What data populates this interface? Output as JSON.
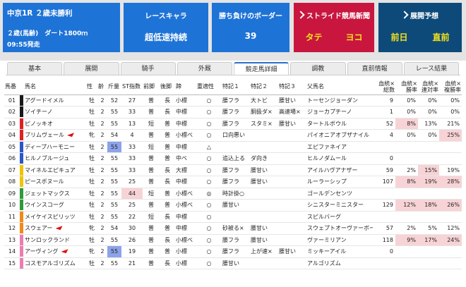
{
  "race": {
    "title": "中京1R ２歳未勝利",
    "cond": "２歳(馬齢)　ダート1800ｍ",
    "time": "09:55発走"
  },
  "cards": [
    {
      "header": "レースキャラ",
      "value": "超低速持続"
    },
    {
      "header": "勝ち負けのボーダー",
      "value": "39"
    },
    {
      "header": "ストライド競馬新聞",
      "a": "タテ",
      "b": "ヨコ"
    },
    {
      "header": "展開予想",
      "a": "前日",
      "b": "直前"
    }
  ],
  "tabs": [
    "基本",
    "展開",
    "騎手",
    "外厩",
    "競走馬詳細",
    "調教",
    "直前情報",
    "レース結果"
  ],
  "columns": [
    "馬番",
    "馬名",
    "性",
    "齢",
    "斤量",
    "ST指数",
    "前脚",
    "後脚",
    "蹄",
    "重適性",
    "特記１",
    "特記２",
    "特記３",
    "父馬名",
    "血統×総数",
    "血統×勝率",
    "血統×連対率",
    "血統×複勝率"
  ],
  "colors": {
    "header_bg": "#1e73d6",
    "shinbun_bg": "#c8163f",
    "tenkai_bg": "#0d4a7a",
    "highlight_pink": "#f7d3d6",
    "highlight_blue": "#8ca3ea",
    "sub_text": "#f5e21a"
  },
  "horses": [
    {
      "no": "01",
      "name": "アグードイメル",
      "sex": "牡",
      "age": "2",
      "kin": "52",
      "st": "27",
      "mae": "普",
      "ato": "長",
      "tei": "小標",
      "om": "○",
      "s1": "腰フラ",
      "s2": "大トビ",
      "s3": "腰甘い",
      "sire": "トーセンジョーダン",
      "tot": "9",
      "w": "0%",
      "r": "0%",
      "f": "0%",
      "color": "#1a1a1a",
      "flag": false,
      "kinH": "",
      "stH": "",
      "wH": "",
      "rH": "",
      "fH": ""
    },
    {
      "no": "02",
      "name": "ソイチーノ",
      "sex": "牡",
      "age": "2",
      "kin": "55",
      "st": "33",
      "mae": "普",
      "ato": "長",
      "tei": "中標",
      "om": "○",
      "s1": "腰フラ",
      "s2": "胴扱ダ×",
      "s3": "高速場×",
      "sire": "ジョーカプチーノ",
      "tot": "1",
      "w": "0%",
      "r": "0%",
      "f": "0%",
      "color": "#1a1a1a",
      "flag": false,
      "kinH": "",
      "stH": "",
      "wH": "",
      "rH": "",
      "fH": ""
    },
    {
      "no": "03",
      "name": "ピノッキオ",
      "sex": "牡",
      "age": "2",
      "kin": "55",
      "st": "13",
      "mae": "短",
      "ato": "普",
      "tei": "中標",
      "om": "○",
      "s1": "腰フラ",
      "s2": "スタミ×",
      "s3": "腰甘い",
      "sire": "タートルボウル",
      "tot": "52",
      "w": "8%",
      "r": "13%",
      "f": "21%",
      "color": "#e02020",
      "flag": false,
      "kinH": "",
      "stH": "",
      "wH": "pk",
      "rH": "",
      "fH": ""
    },
    {
      "no": "04",
      "name": "ブリムヴェール",
      "sex": "牝",
      "age": "2",
      "kin": "54",
      "st": "4",
      "mae": "普",
      "ato": "普",
      "tei": "小標べ",
      "om": "○",
      "s1": "口向悪い",
      "s2": "",
      "s3": "",
      "sire": "パイオニアオブザナイル",
      "tot": "4",
      "w": "0%",
      "r": "0%",
      "f": "25%",
      "color": "#e02020",
      "flag": true,
      "kinH": "",
      "stH": "",
      "wH": "",
      "rH": "",
      "fH": "pk"
    },
    {
      "no": "05",
      "name": "ディープハーモニー",
      "sex": "牡",
      "age": "2",
      "kin": "55",
      "st": "33",
      "mae": "短",
      "ato": "普",
      "tei": "中標",
      "om": "△",
      "s1": "",
      "s2": "",
      "s3": "",
      "sire": "エピファネイア",
      "tot": "",
      "w": "",
      "r": "",
      "f": "",
      "color": "#2a56c6",
      "flag": false,
      "kinH": "bl",
      "stH": "",
      "wH": "",
      "rH": "",
      "fH": ""
    },
    {
      "no": "06",
      "name": "ヒルノブルージュ",
      "sex": "牡",
      "age": "2",
      "kin": "55",
      "st": "33",
      "mae": "普",
      "ato": "普",
      "tei": "中べ",
      "om": "○",
      "s1": "追込上る",
      "s2": "ダ向き",
      "s3": "",
      "sire": "ヒルノダムール",
      "tot": "0",
      "w": "",
      "r": "",
      "f": "",
      "color": "#2a56c6",
      "flag": false,
      "kinH": "",
      "stH": "",
      "wH": "",
      "rH": "",
      "fH": ""
    },
    {
      "no": "07",
      "name": "マイネルエピキュア",
      "sex": "牡",
      "age": "2",
      "kin": "55",
      "st": "33",
      "mae": "普",
      "ato": "長",
      "tei": "大標",
      "om": "○",
      "s1": "腰フラ",
      "s2": "腰甘い",
      "s3": "",
      "sire": "アイルハヴアナザー",
      "tot": "59",
      "w": "2%",
      "r": "15%",
      "f": "19%",
      "color": "#f0c400",
      "flag": false,
      "kinH": "",
      "stH": "",
      "wH": "",
      "rH": "pk",
      "fH": ""
    },
    {
      "no": "08",
      "name": "ピースボヌール",
      "sex": "牡",
      "age": "2",
      "kin": "55",
      "st": "25",
      "mae": "普",
      "ato": "長",
      "tei": "中標",
      "om": "○",
      "s1": "腰フラ",
      "s2": "腰甘い",
      "s3": "",
      "sire": "ルーラーシップ",
      "tot": "107",
      "w": "8%",
      "r": "19%",
      "f": "28%",
      "color": "#f0c400",
      "flag": false,
      "kinH": "",
      "stH": "",
      "wH": "pk",
      "rH": "pk",
      "fH": "pk"
    },
    {
      "no": "09",
      "name": "ジェットマックス",
      "sex": "牡",
      "age": "2",
      "kin": "55",
      "st": "44",
      "mae": "短",
      "ato": "普",
      "tei": "小標べ",
      "om": "◎",
      "s1": "時計掛○",
      "s2": "",
      "s3": "",
      "sire": "ゴールデンセンツ",
      "tot": "",
      "w": "",
      "r": "",
      "f": "",
      "color": "#2e9a3a",
      "flag": false,
      "kinH": "",
      "stH": "pk",
      "wH": "",
      "rH": "",
      "fH": ""
    },
    {
      "no": "10",
      "name": "ウインスコーグ",
      "sex": "牡",
      "age": "2",
      "kin": "55",
      "st": "25",
      "mae": "普",
      "ato": "普",
      "tei": "小標べ",
      "om": "○",
      "s1": "腰甘い",
      "s2": "",
      "s3": "",
      "sire": "シニスターミニスター",
      "tot": "129",
      "w": "12%",
      "r": "18%",
      "f": "26%",
      "color": "#2e9a3a",
      "flag": false,
      "kinH": "",
      "stH": "",
      "wH": "pk",
      "rH": "pk",
      "fH": "pk"
    },
    {
      "no": "11",
      "name": "メイケイスピリッツ",
      "sex": "牡",
      "age": "2",
      "kin": "55",
      "st": "22",
      "mae": "短",
      "ato": "長",
      "tei": "中標",
      "om": "○",
      "s1": "",
      "s2": "",
      "s3": "",
      "sire": "スピルバーグ",
      "tot": "",
      "w": "",
      "r": "",
      "f": "",
      "color": "#f08a1a",
      "flag": false,
      "kinH": "",
      "stH": "",
      "wH": "",
      "rH": "",
      "fH": ""
    },
    {
      "no": "12",
      "name": "スウェアー",
      "sex": "牝",
      "age": "2",
      "kin": "54",
      "st": "30",
      "mae": "普",
      "ato": "普",
      "tei": "中標",
      "om": "○",
      "s1": "砂被る×",
      "s2": "腰甘い",
      "s3": "",
      "sire": "スウェプトオーヴァーボード",
      "tot": "57",
      "w": "2%",
      "r": "5%",
      "f": "12%",
      "color": "#f08a1a",
      "flag": true,
      "kinH": "",
      "stH": "",
      "wH": "",
      "rH": "",
      "fH": ""
    },
    {
      "no": "13",
      "name": "サンロックランド",
      "sex": "牡",
      "age": "2",
      "kin": "55",
      "st": "26",
      "mae": "普",
      "ato": "長",
      "tei": "小標べ",
      "om": "○",
      "s1": "腰フラ",
      "s2": "腰甘い",
      "s3": "",
      "sire": "ヴァーミリアン",
      "tot": "118",
      "w": "9%",
      "r": "17%",
      "f": "24%",
      "color": "#ee7db0",
      "flag": false,
      "kinH": "",
      "stH": "",
      "wH": "pk",
      "rH": "pk",
      "fH": "pk"
    },
    {
      "no": "14",
      "name": "アーヴィング",
      "sex": "牝",
      "age": "2",
      "kin": "55",
      "st": "19",
      "mae": "普",
      "ato": "普",
      "tei": "小標",
      "om": "○",
      "s1": "腰フラ",
      "s2": "上が速×",
      "s3": "腰甘い",
      "sire": "ミッキーアイル",
      "tot": "0",
      "w": "",
      "r": "",
      "f": "",
      "color": "#ee7db0",
      "flag": true,
      "kinH": "bl",
      "stH": "",
      "wH": "",
      "rH": "",
      "fH": ""
    },
    {
      "no": "15",
      "name": "コスモアルゴリズム",
      "sex": "牡",
      "age": "2",
      "kin": "55",
      "st": "21",
      "mae": "普",
      "ato": "長",
      "tei": "小標",
      "om": "○",
      "s1": "腰甘い",
      "s2": "",
      "s3": "",
      "sire": "アルゴリズム",
      "tot": "",
      "w": "",
      "r": "",
      "f": "",
      "color": "#ee7db0",
      "flag": false,
      "kinH": "",
      "stH": "",
      "wH": "",
      "rH": "",
      "fH": ""
    }
  ]
}
